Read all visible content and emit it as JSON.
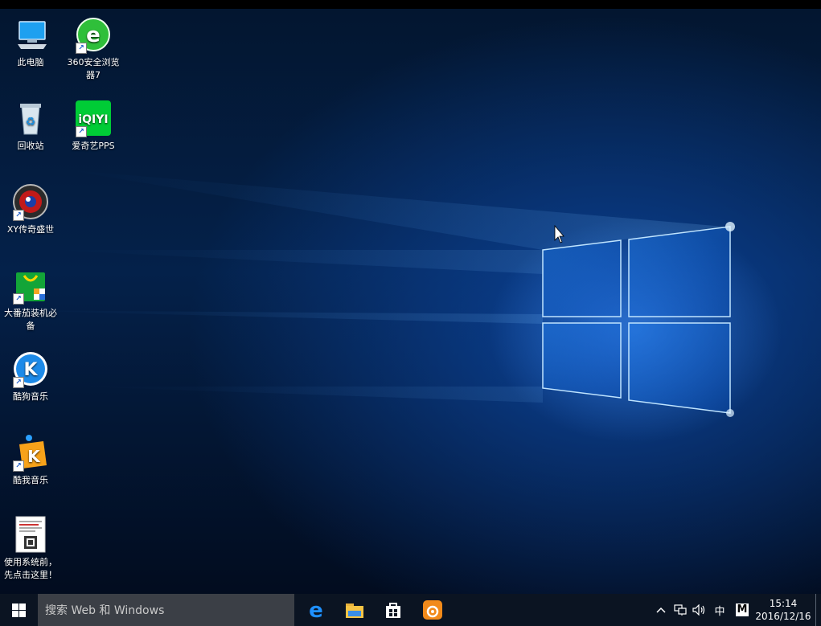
{
  "desktop": {
    "icons": [
      {
        "label": "此电脑",
        "icon": "computer-icon"
      },
      {
        "label": "360安全浏览器7",
        "icon": "browser-360-icon"
      },
      {
        "label": "回收站",
        "icon": "recycle-bin-icon"
      },
      {
        "label": "爱奇艺PPS",
        "icon": "iqiyi-icon"
      },
      {
        "label": "XY传奇盛世",
        "icon": "game-icon"
      },
      {
        "label": "大番茄装机必备",
        "icon": "shopping-bag-icon"
      },
      {
        "label": "酷狗音乐",
        "icon": "kugou-icon"
      },
      {
        "label": "酷我音乐",
        "icon": "kuwo-icon"
      },
      {
        "label": "使用系统前，先点击这里！",
        "icon": "document-icon"
      }
    ],
    "iqiyi_text": "iQIYI",
    "kugou_letter": "K",
    "kuwo_letter": "K"
  },
  "taskbar": {
    "search_placeholder": "搜索 Web 和 Windows",
    "apps": [
      {
        "name": "edge",
        "icon": "edge-icon"
      },
      {
        "name": "file-explorer",
        "icon": "folder-icon"
      },
      {
        "name": "store",
        "icon": "store-icon"
      },
      {
        "name": "uc-browser",
        "icon": "uc-browser-icon"
      }
    ],
    "tray": {
      "chevron": "^",
      "ime": "中",
      "ime_mode": "M",
      "time": "15:14",
      "date": "2016/12/16"
    }
  },
  "colors": {
    "taskbar": "#0b1422",
    "search": "#3b3f46",
    "accent": "#1e90ff"
  }
}
